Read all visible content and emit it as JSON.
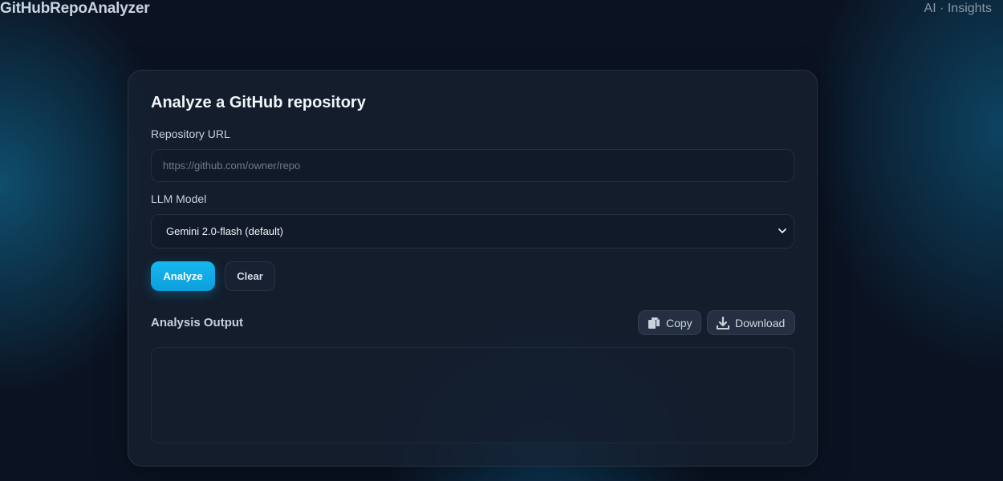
{
  "header": {
    "brand": "GitHubRepoAnalyzer",
    "tagline": "AI · Insights"
  },
  "form": {
    "title": "Analyze a GitHub repository",
    "url_label": "Repository URL",
    "url_placeholder": "https://github.com/owner/repo",
    "url_value": "",
    "model_label": "LLM Model",
    "model_selected": "Gemini 2.0-flash (default)",
    "analyze_label": "Analyze",
    "clear_label": "Clear"
  },
  "output": {
    "title": "Analysis Output",
    "copy_label": "Copy",
    "download_label": "Download",
    "content": ""
  },
  "icons": {
    "copy": "copy-icon",
    "download": "download-icon",
    "select_arrow": "chevron-down-icon"
  },
  "colors": {
    "accent": "#17b6ef",
    "background": "#0b1322",
    "card": "#162030"
  }
}
